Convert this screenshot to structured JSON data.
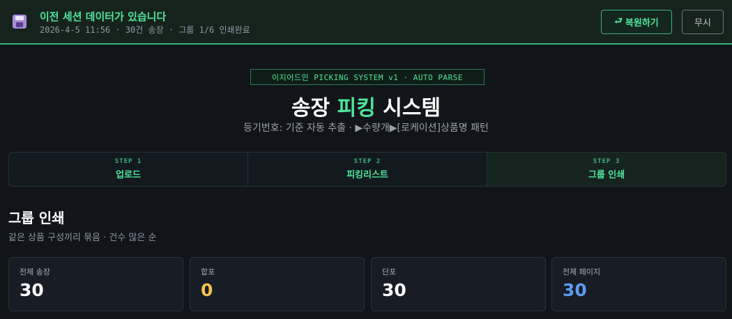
{
  "banner": {
    "icon": "floppy-disk-icon",
    "title": "이전 세션 데이터가 있습니다",
    "meta": "2026-4-5 11:56 · 30건 송장 · 그룹 1/6 인쇄완료",
    "restore_icon": "return-arrow-icon",
    "restore_label": "복원하기",
    "ignore_label": "무시",
    "accent_color": "#4ee59a"
  },
  "hero": {
    "tag": "이지어드민 PICKING SYSTEM v1 · AUTO PARSE",
    "title_prefix": "송장 ",
    "title_accent": "피킹",
    "title_suffix": " 시스템",
    "subtitle": "등기번호: 기준 자동 추출 · ▶수량개▶[로케이션]상품명 패턴"
  },
  "steps": [
    {
      "num": "STEP 1",
      "label": "업로드",
      "active": false
    },
    {
      "num": "STEP 2",
      "label": "피킹리스트",
      "active": false
    },
    {
      "num": "STEP 3",
      "label": "그룹 인쇄",
      "active": true
    }
  ],
  "section": {
    "title": "그룹 인쇄",
    "subtitle": "같은 상품 구성끼리 묶음 · 건수 많은 순"
  },
  "stats": [
    {
      "label": "전체 송장",
      "value": "30",
      "color": "#ffffff"
    },
    {
      "label": "합포",
      "value": "0",
      "color": "#f2c14e"
    },
    {
      "label": "단포",
      "value": "30",
      "color": "#ffffff"
    },
    {
      "label": "전체 페이지",
      "value": "30",
      "color": "#5b9cf0"
    }
  ]
}
